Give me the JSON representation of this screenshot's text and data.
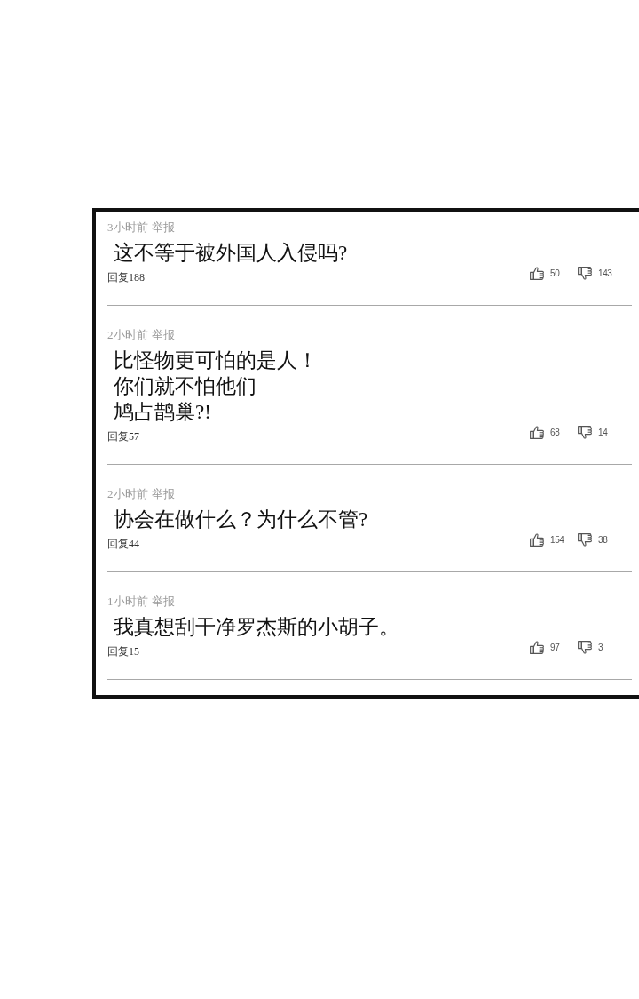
{
  "comments": [
    {
      "time": "3小时前",
      "report": "举报",
      "text_lines": [
        "这不等于被外国人入侵吗?"
      ],
      "reply": "回复188",
      "likes": "50",
      "dislikes": "143"
    },
    {
      "time": "2小时前",
      "report": "举报",
      "text_lines": [
        "比怪物更可怕的是人！",
        "你们就不怕他们",
        "鸠占鹊巢?!"
      ],
      "reply": "回复57",
      "likes": "68",
      "dislikes": "14"
    },
    {
      "time": "2小时前",
      "report": "举报",
      "text_lines": [
        "协会在做什么？为什么不管?"
      ],
      "reply": "回复44",
      "likes": "154",
      "dislikes": "38"
    },
    {
      "time": "1小时前",
      "report": "举报",
      "text_lines": [
        "我真想刮干净罗杰斯的小胡子。"
      ],
      "reply": "回复15",
      "likes": "97",
      "dislikes": "3"
    }
  ]
}
